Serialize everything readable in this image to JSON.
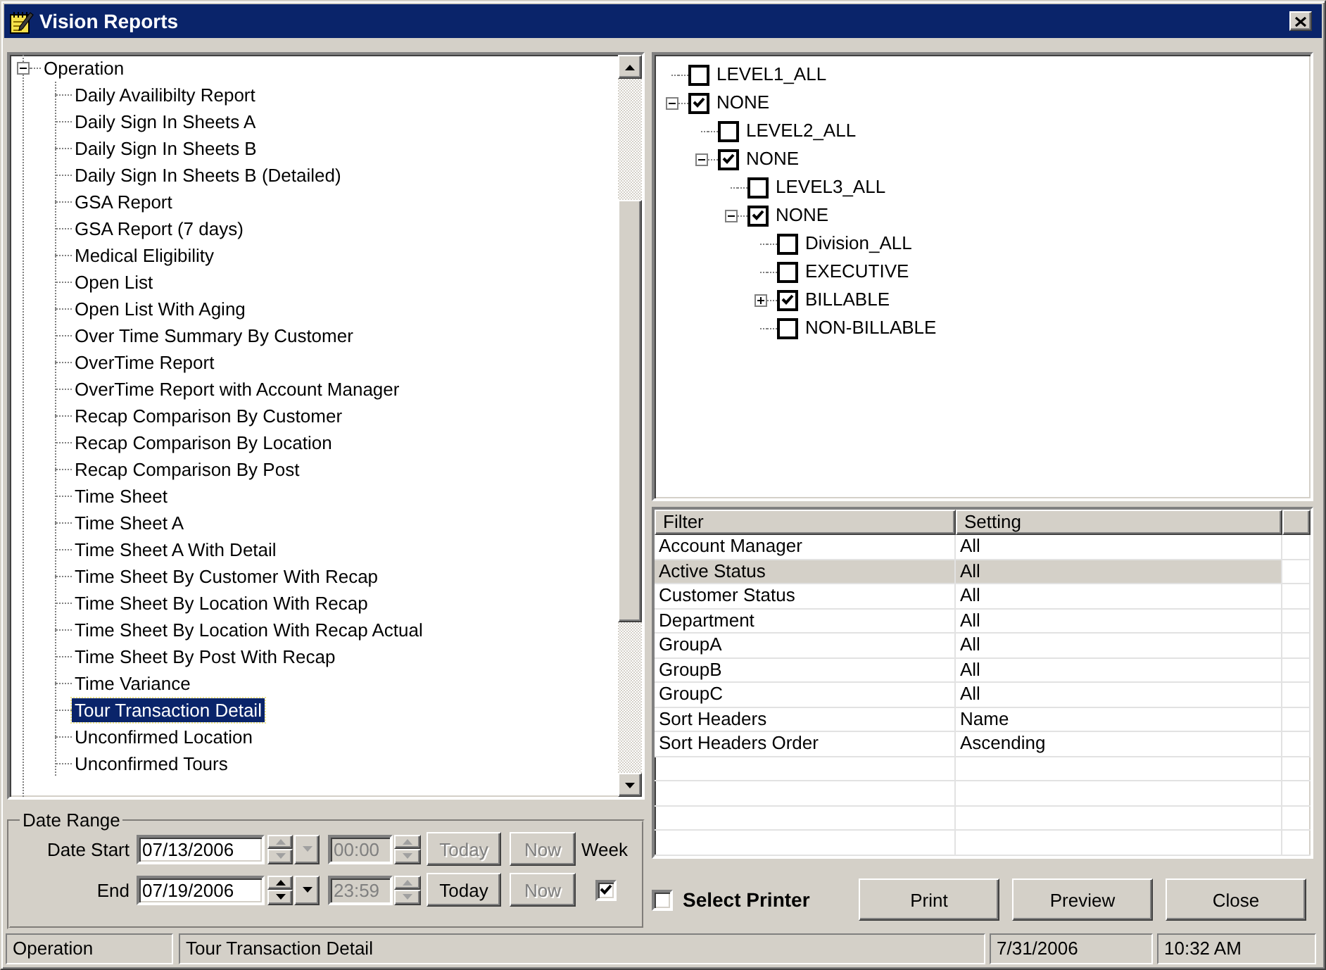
{
  "window": {
    "title": "Vision Reports"
  },
  "report_tree": {
    "root": {
      "label": "Operation",
      "selected": false,
      "expanded": true,
      "children": [
        {
          "label": "Daily Availibilty Report",
          "selected": false
        },
        {
          "label": "Daily Sign In Sheets A",
          "selected": false
        },
        {
          "label": "Daily Sign In Sheets B",
          "selected": false
        },
        {
          "label": "Daily Sign In Sheets B (Detailed)",
          "selected": false
        },
        {
          "label": "GSA Report",
          "selected": false
        },
        {
          "label": "GSA Report (7 days)",
          "selected": false
        },
        {
          "label": "Medical Eligibility",
          "selected": false
        },
        {
          "label": "Open List",
          "selected": false
        },
        {
          "label": "Open List With Aging",
          "selected": false
        },
        {
          "label": "Over Time Summary By Customer",
          "selected": false
        },
        {
          "label": "OverTime Report",
          "selected": false
        },
        {
          "label": "OverTime Report with Account Manager",
          "selected": false
        },
        {
          "label": "Recap Comparison By Customer",
          "selected": false
        },
        {
          "label": "Recap Comparison By Location",
          "selected": false
        },
        {
          "label": "Recap Comparison By Post",
          "selected": false
        },
        {
          "label": "Time Sheet",
          "selected": false
        },
        {
          "label": "Time Sheet A",
          "selected": false
        },
        {
          "label": "Time Sheet A With Detail",
          "selected": false
        },
        {
          "label": "Time Sheet By Customer With Recap",
          "selected": false
        },
        {
          "label": "Time Sheet By Location With Recap",
          "selected": false
        },
        {
          "label": "Time Sheet By Location With Recap Actual",
          "selected": false
        },
        {
          "label": "Time Sheet By Post With Recap",
          "selected": false
        },
        {
          "label": "Time Variance",
          "selected": false
        },
        {
          "label": "Tour Transaction Detail",
          "selected": true
        },
        {
          "label": "Unconfirmed Location",
          "selected": false
        },
        {
          "label": "Unconfirmed Tours",
          "selected": false
        }
      ]
    }
  },
  "date_range": {
    "title": "Date Range",
    "rows": [
      {
        "label": "Date Start",
        "date": "07/13/2006",
        "date_buttons_disabled": true,
        "time": "00:00",
        "time_disabled": true,
        "today": {
          "label": "Today",
          "disabled": true
        },
        "now": {
          "label": "Now",
          "disabled": true
        }
      },
      {
        "label": "End",
        "date": "07/19/2006",
        "date_buttons_disabled": false,
        "time": "23:59",
        "time_disabled": true,
        "today": {
          "label": "Today",
          "disabled": false
        },
        "now": {
          "label": "Now",
          "disabled": true
        }
      }
    ],
    "week": {
      "label": "Week",
      "checked": true
    }
  },
  "filter_tree": {
    "items": [
      {
        "label": "LEVEL1_ALL",
        "checked": false
      },
      {
        "label": "NONE",
        "checked": true,
        "expanded": true,
        "children": [
          {
            "label": "LEVEL2_ALL",
            "checked": false
          },
          {
            "label": "NONE",
            "checked": true,
            "expanded": true,
            "children": [
              {
                "label": "LEVEL3_ALL",
                "checked": false
              },
              {
                "label": "NONE",
                "checked": true,
                "expanded": true,
                "children": [
                  {
                    "label": "Division_ALL",
                    "checked": false
                  },
                  {
                    "label": "EXECUTIVE",
                    "checked": false
                  },
                  {
                    "label": "BILLABLE",
                    "checked": true,
                    "expanded": false
                  },
                  {
                    "label": "NON-BILLABLE",
                    "checked": false
                  }
                ]
              }
            ]
          }
        ]
      }
    ]
  },
  "filter_table": {
    "columns": [
      "Filter",
      "Setting"
    ],
    "rows": [
      {
        "cells": [
          "Account Manager",
          "All"
        ],
        "selected": false
      },
      {
        "cells": [
          "Active Status",
          "All"
        ],
        "selected": true
      },
      {
        "cells": [
          "Customer Status",
          "All"
        ],
        "selected": false
      },
      {
        "cells": [
          "Department",
          "All"
        ],
        "selected": false
      },
      {
        "cells": [
          "GroupA",
          "All"
        ],
        "selected": false
      },
      {
        "cells": [
          "GroupB",
          "All"
        ],
        "selected": false
      },
      {
        "cells": [
          "GroupC",
          "All"
        ],
        "selected": false
      },
      {
        "cells": [
          "Sort Headers",
          "Name"
        ],
        "selected": false
      },
      {
        "cells": [
          "Sort Headers Order",
          "Ascending"
        ],
        "selected": false
      }
    ]
  },
  "select_printer": {
    "label": "Select Printer",
    "checked": false
  },
  "buttons": [
    "Print",
    "Preview",
    "Close"
  ],
  "status_bar": [
    "Operation",
    "Tour Transaction Detail",
    "7/31/2006",
    "10:32 AM"
  ]
}
